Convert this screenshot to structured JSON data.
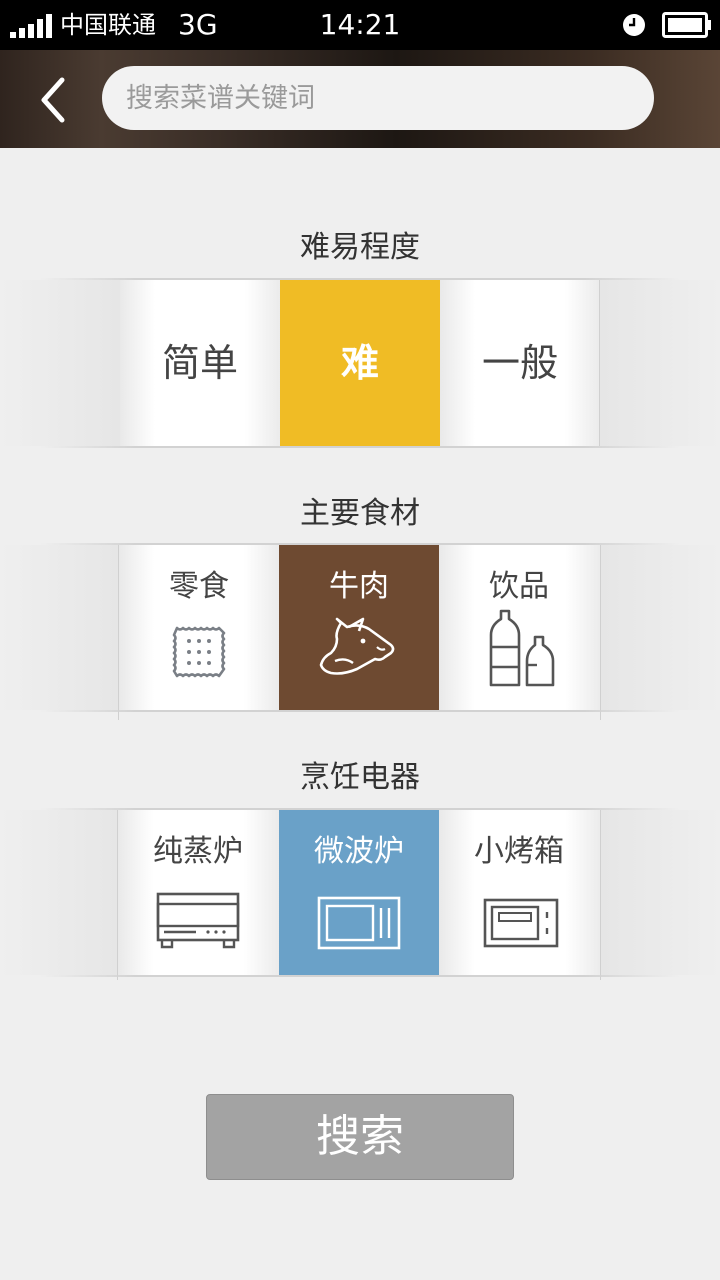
{
  "status_bar": {
    "carrier": "中国联通",
    "network": "3G",
    "time": "14:21"
  },
  "header": {
    "search_placeholder": "搜索菜谱关键词"
  },
  "difficulty": {
    "title": "难易程度",
    "options": [
      "简单",
      "难",
      "一般"
    ],
    "selected": "难"
  },
  "ingredient": {
    "title": "主要食材",
    "options": [
      {
        "label": "零食",
        "icon": "cracker-icon"
      },
      {
        "label": "牛肉",
        "icon": "cow-head-icon"
      },
      {
        "label": "饮品",
        "icon": "bottles-icon"
      }
    ],
    "selected": "牛肉"
  },
  "appliance": {
    "title": "烹饪电器",
    "options": [
      {
        "label": "纯蒸炉",
        "icon": "steam-oven-icon"
      },
      {
        "label": "微波炉",
        "icon": "microwave-icon"
      },
      {
        "label": "小烤箱",
        "icon": "toaster-oven-icon"
      }
    ],
    "selected": "微波炉"
  },
  "search_button": {
    "label": "搜索"
  },
  "colors": {
    "difficulty_selected": "#f0bc25",
    "ingredient_selected": "#6e4a31",
    "appliance_selected": "#6aa1c8",
    "search_button": "#a3a3a3"
  }
}
